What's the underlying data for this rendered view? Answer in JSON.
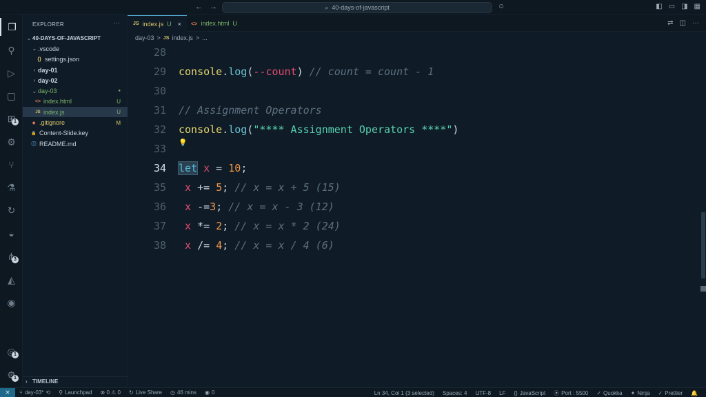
{
  "titlebar": {
    "back": "←",
    "forward": "→",
    "search_icon": "⌕",
    "search_text": "40-days-of-javascript",
    "copilot_icon": "☺",
    "layout_icons": [
      "◧",
      "▭",
      "◨",
      "▦"
    ]
  },
  "activity": {
    "explorer": "❐",
    "search": "⚲",
    "run_debug": "▷",
    "remote": "▢",
    "extensions": "⊞",
    "extensions_badge": "1",
    "testing_bug": "⚙",
    "git": "⑂",
    "flask": "⚗",
    "live_share": "↻",
    "docker": "◒",
    "source_control": "⋔",
    "source_control_badge": "3",
    "azure": "◭",
    "github": "◉",
    "accounts": "◎",
    "accounts_badge": "1",
    "settings": "⚙",
    "settings_badge": "1"
  },
  "sidebar": {
    "title": "EXPLORER",
    "more": "···",
    "root": "40-DAYS-OF-JAVASCRIPT",
    "items": [
      {
        "label": ".vscode",
        "chev": "⌄",
        "icon": "",
        "status": ""
      },
      {
        "label": "settings.json",
        "chev": "",
        "icon": "{}",
        "status": ""
      },
      {
        "label": "day-01",
        "chev": "›",
        "icon": "",
        "status": ""
      },
      {
        "label": "day-02",
        "chev": "›",
        "icon": "",
        "status": ""
      },
      {
        "label": "day-03",
        "chev": "⌄",
        "icon": "",
        "status": "●"
      },
      {
        "label": "index.html",
        "chev": "",
        "icon": "<>",
        "status": "U"
      },
      {
        "label": "index.js",
        "chev": "",
        "icon": "JS",
        "status": "U"
      },
      {
        "label": ".gitignore",
        "chev": "",
        "icon": "◆",
        "status": "M"
      },
      {
        "label": "Content-Slide.key",
        "chev": "",
        "icon": "🔒",
        "status": ""
      },
      {
        "label": "README.md",
        "chev": "",
        "icon": "ⓘ",
        "status": ""
      }
    ],
    "timeline": "TIMELINE"
  },
  "tabs": [
    {
      "icon": "JS",
      "label": "index.js",
      "status": "U",
      "close": "×"
    },
    {
      "icon": "<>",
      "label": "index.html",
      "status": "U",
      "close": ""
    }
  ],
  "tab_actions": [
    "⇄",
    "◫",
    "···"
  ],
  "breadcrumb": {
    "folder": "day-03",
    "sep1": ">",
    "icon": "JS",
    "file": "index.js",
    "sep2": ">",
    "more": "..."
  },
  "editor": {
    "lines": [
      {
        "num": "28"
      },
      {
        "num": "29"
      },
      {
        "num": "30"
      },
      {
        "num": "31"
      },
      {
        "num": "32"
      },
      {
        "num": "33"
      },
      {
        "num": "34"
      },
      {
        "num": "35"
      },
      {
        "num": "36"
      },
      {
        "num": "37"
      },
      {
        "num": "38"
      }
    ],
    "code": {
      "l29": {
        "obj": "console",
        "dot": ".",
        "fn": "log",
        "open": "(",
        "op": "--",
        "var": "count",
        "close": ")",
        "comment": " // count = count - 1"
      },
      "l31": {
        "comment": "// Assignment Operators"
      },
      "l32": {
        "obj": "console",
        "dot": ".",
        "fn": "log",
        "open": "(",
        "str": "\"**** Assignment Operators ****\"",
        "close": ")"
      },
      "l33": {
        "bulb": "💡"
      },
      "l34": {
        "kw": "let",
        "sp": " ",
        "var": "x",
        "op": " = ",
        "num": "10",
        "semi": ";"
      },
      "l35": {
        "indent": " ",
        "var": "x",
        "op": " += ",
        "num": "5",
        "semi": ";",
        "comment": " // x = x + 5 (15)"
      },
      "l36": {
        "indent": " ",
        "var": "x",
        "op": " -=",
        "num": "3",
        "semi": ";",
        "comment": " // x = x - 3 (12)"
      },
      "l37": {
        "indent": " ",
        "var": "x",
        "op": " *= ",
        "num": "2",
        "semi": ";",
        "comment": " // x = x * 2 (24)"
      },
      "l38": {
        "indent": " ",
        "var": "x",
        "op": " /= ",
        "num": "4",
        "semi": ";",
        "comment": " // x = x / 4 (6)"
      }
    }
  },
  "statusbar": {
    "remote_icon": "⨯",
    "branch": "day-03*",
    "launchpad": "Launchpad",
    "problems": "⊗ 0 ⚠ 0",
    "live_share": "Live Share",
    "time": "46 mins",
    "ports": "0",
    "cursor": "Ln 34, Col 1 (3 selected)",
    "spaces": "Spaces: 4",
    "encoding": "UTF-8",
    "eol": "LF",
    "language": "JavaScript",
    "port": "Port : 5500",
    "quokka": "Quokka",
    "ninja": "Ninja",
    "prettier": "Prettier"
  },
  "colors": {
    "background": "#0f1b26",
    "keyword": "#54b8d6",
    "variable": "#e24d72",
    "number": "#f2994a",
    "string": "#57d1b0",
    "comment": "#5d7080",
    "accent": "#4fa3c8"
  }
}
